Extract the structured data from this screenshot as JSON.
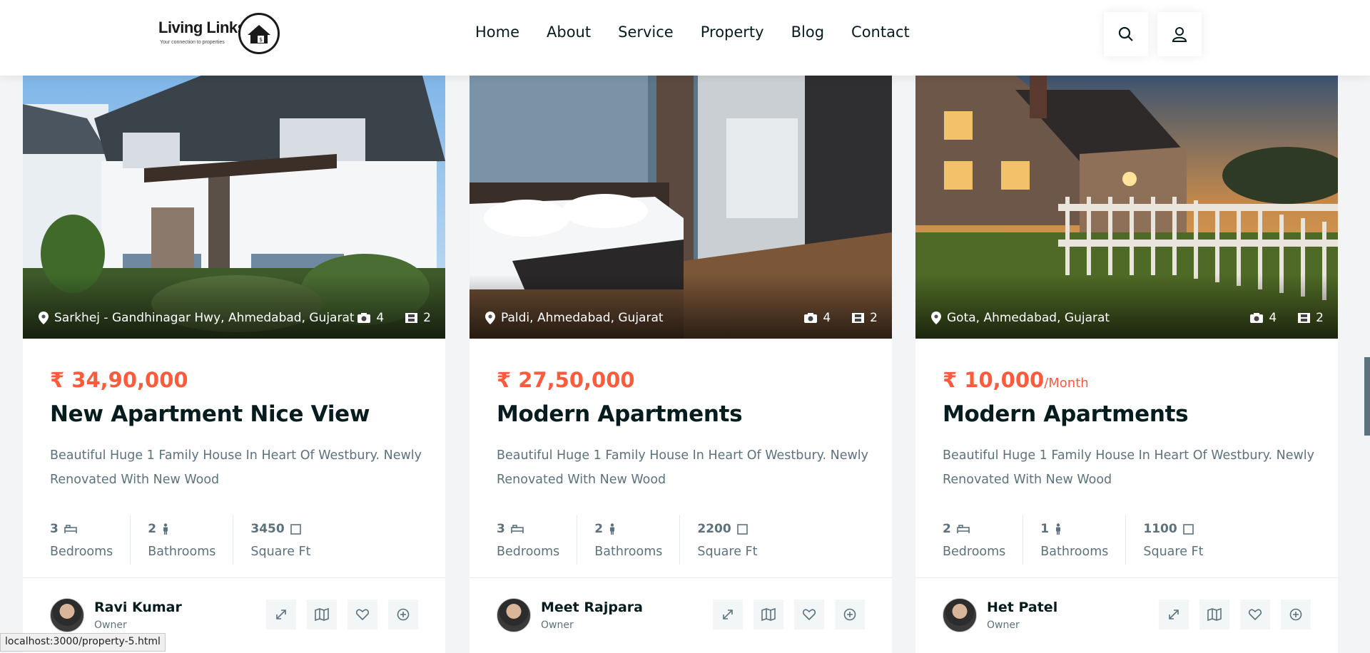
{
  "header": {
    "logo_text": "Living Links",
    "logo_tagline": "Your connection to properties",
    "nav": [
      "Home",
      "About",
      "Service",
      "Property",
      "Blog",
      "Contact"
    ],
    "search_icon": "search-icon",
    "user_icon": "user-icon"
  },
  "properties": [
    {
      "location": "Sarkhej - Gandhinagar Hwy, Ahmedabad, Gujarat",
      "photos": "4",
      "videos": "2",
      "price": "₹ 34,90,000",
      "price_suffix": "",
      "title": "New Apartment Nice View",
      "description": "Beautiful Huge 1 Family House In Heart Of Westbury. Newly Renovated With New Wood",
      "bedrooms": "3",
      "bathrooms": "2",
      "area": "3450",
      "bedrooms_label": "Bedrooms",
      "bathrooms_label": "Bathrooms",
      "area_label": "Square Ft",
      "agent_name": "Ravi Kumar",
      "agent_role": "Owner"
    },
    {
      "location": "Paldi, Ahmedabad, Gujarat",
      "photos": "4",
      "videos": "2",
      "price": "₹ 27,50,000",
      "price_suffix": "",
      "title": "Modern Apartments",
      "description": "Beautiful Huge 1 Family House In Heart Of Westbury. Newly Renovated With New Wood",
      "bedrooms": "3",
      "bathrooms": "2",
      "area": "2200",
      "bedrooms_label": "Bedrooms",
      "bathrooms_label": "Bathrooms",
      "area_label": "Square Ft",
      "agent_name": "Meet Rajpara",
      "agent_role": "Owner"
    },
    {
      "location": "Gota, Ahmedabad, Gujarat",
      "photos": "4",
      "videos": "2",
      "price": "₹ 10,000",
      "price_suffix": "/Month",
      "title": "Modern Apartments",
      "description": "Beautiful Huge 1 Family House In Heart Of Westbury. Newly Renovated With New Wood",
      "bedrooms": "2",
      "bathrooms": "1",
      "area": "1100",
      "bedrooms_label": "Bedrooms",
      "bathrooms_label": "Bathrooms",
      "area_label": "Square Ft",
      "agent_name": "Het Patel",
      "agent_role": "Owner"
    }
  ],
  "card_actions": [
    "expand-icon",
    "map-icon",
    "heart-icon",
    "add-circle-icon"
  ],
  "status_bar": "localhost:3000/property-5.html",
  "colors": {
    "accent": "#ff5a3c",
    "heading": "#071c1f",
    "muted": "#5c727d"
  }
}
